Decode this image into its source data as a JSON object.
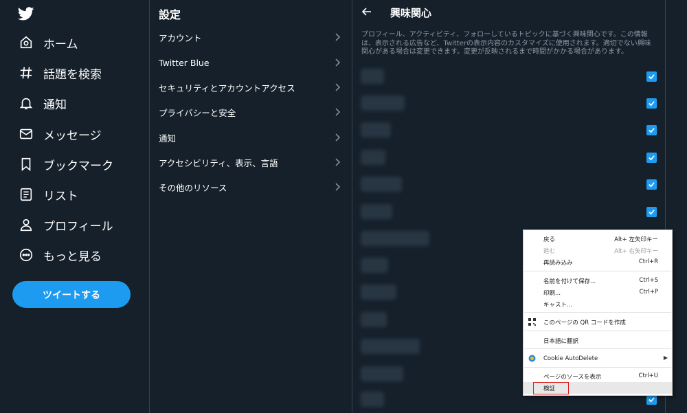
{
  "nav": {
    "items": [
      {
        "label": "ホーム",
        "icon": "home-icon"
      },
      {
        "label": "話題を検索",
        "icon": "hashtag-icon"
      },
      {
        "label": "通知",
        "icon": "bell-icon"
      },
      {
        "label": "メッセージ",
        "icon": "mail-icon"
      },
      {
        "label": "ブックマーク",
        "icon": "bookmark-icon"
      },
      {
        "label": "リスト",
        "icon": "list-icon"
      },
      {
        "label": "プロフィール",
        "icon": "person-icon"
      },
      {
        "label": "もっと見る",
        "icon": "more-icon"
      }
    ],
    "tweet_label": "ツイートする"
  },
  "settings": {
    "title": "設定",
    "items": [
      {
        "label": "アカウント"
      },
      {
        "label": "Twitter Blue"
      },
      {
        "label": "セキュリティとアカウントアクセス"
      },
      {
        "label": "プライバシーと安全"
      },
      {
        "label": "通知"
      },
      {
        "label": "アクセシビリティ、表示、言語"
      },
      {
        "label": "その他のリソース"
      }
    ]
  },
  "interests": {
    "title": "興味関心",
    "description": "プロフィール、アクティビティ、フォローしているトピックに基づく興味関心です。この情報は、表示される広告など、Twitterの表示内容のカスタマイズに使用されます。適切でない興味関心がある場合は変更できます。変更が反映されるまで時間がかかる場合があります。",
    "rows_checked": [
      true,
      true,
      true,
      true,
      true,
      true,
      true,
      true,
      true,
      true,
      true,
      true,
      true
    ]
  },
  "context_menu": {
    "items": [
      {
        "label": "戻る",
        "shortcut": "Alt+ 左矢印キー",
        "disabled": false
      },
      {
        "label": "進む",
        "shortcut": "Alt+ 右矢印キー",
        "disabled": true
      },
      {
        "label": "再読み込み",
        "shortcut": "Ctrl+R",
        "disabled": false
      },
      {
        "label": "名前を付けて保存...",
        "shortcut": "Ctrl+S",
        "disabled": false
      },
      {
        "label": "印刷...",
        "shortcut": "Ctrl+P",
        "disabled": false
      },
      {
        "label": "キャスト...",
        "shortcut": "",
        "disabled": false
      },
      {
        "label": "このページの QR コードを作成",
        "shortcut": "",
        "disabled": false
      },
      {
        "label": "日本語に翻訳",
        "shortcut": "",
        "disabled": false
      },
      {
        "label": "Cookie AutoDelete",
        "shortcut": "",
        "disabled": false
      },
      {
        "label": "ページのソースを表示",
        "shortcut": "Ctrl+U",
        "disabled": false
      },
      {
        "label": "検証",
        "shortcut": "",
        "disabled": false
      }
    ]
  },
  "colors": {
    "background": "#15202b",
    "accent": "#1d9bf0",
    "border": "#38444d",
    "secondary_text": "#8b98a5"
  }
}
